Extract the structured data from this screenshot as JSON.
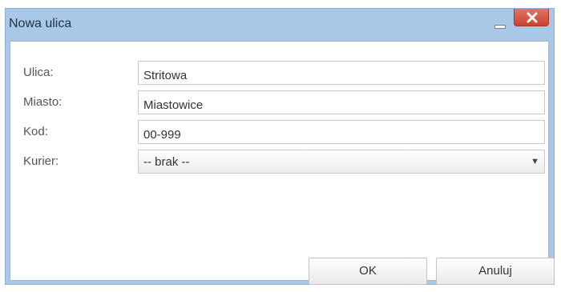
{
  "window": {
    "title": "Nowa ulica"
  },
  "form": {
    "street": {
      "label": "Ulica:",
      "value": "Stritowa"
    },
    "city": {
      "label": "Miasto:",
      "value": "Miastowice"
    },
    "postal_code": {
      "label": "Kod:",
      "value": "00-999"
    },
    "courier": {
      "label": "Kurier:",
      "selected": "-- brak --"
    }
  },
  "buttons": {
    "ok_label": "OK",
    "cancel_label": "Anuluj"
  },
  "icons": {
    "minimize": "minimize-icon",
    "close": "close-icon",
    "dropdown": "chevron-down-icon"
  },
  "colors": {
    "titlebar": "#a9c8e8",
    "close_button": "#c8432f"
  }
}
